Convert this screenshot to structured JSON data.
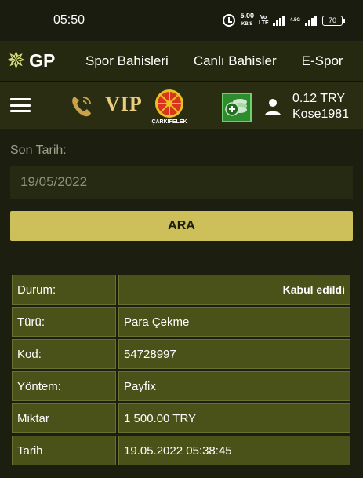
{
  "status_bar": {
    "time": "05:50",
    "net_speed": "5.00",
    "net_unit": "KB/S",
    "volte": "Vo LTE",
    "signal": "4.5G",
    "battery": "70"
  },
  "nav": {
    "logo": "GP",
    "items": [
      "Spor Bahisleri",
      "Canlı Bahisler",
      "E-Spor"
    ]
  },
  "toolbar": {
    "vip_label": "VIP",
    "wheel_label": "ÇARKIFELEK",
    "balance": "0.12 TRY",
    "username": "Kose1981"
  },
  "filter": {
    "label": "Son Tarih:",
    "date_value": "19/05/2022",
    "search_label": "ARA"
  },
  "details": [
    {
      "key": "Durum:",
      "value": "Kabul edildi"
    },
    {
      "key": "Türü:",
      "value": "Para Çekme"
    },
    {
      "key": "Kod:",
      "value": "54728997"
    },
    {
      "key": "Yöntem:",
      "value": "Payfix"
    },
    {
      "key": "Miktar",
      "value": "1 500.00 TRY"
    },
    {
      "key": "Tarih",
      "value": "19.05.2022 05:38:45"
    }
  ],
  "colors": {
    "accent": "#cdbf5a",
    "row_bg": "#4b5219",
    "background": "#1c1e0f"
  }
}
